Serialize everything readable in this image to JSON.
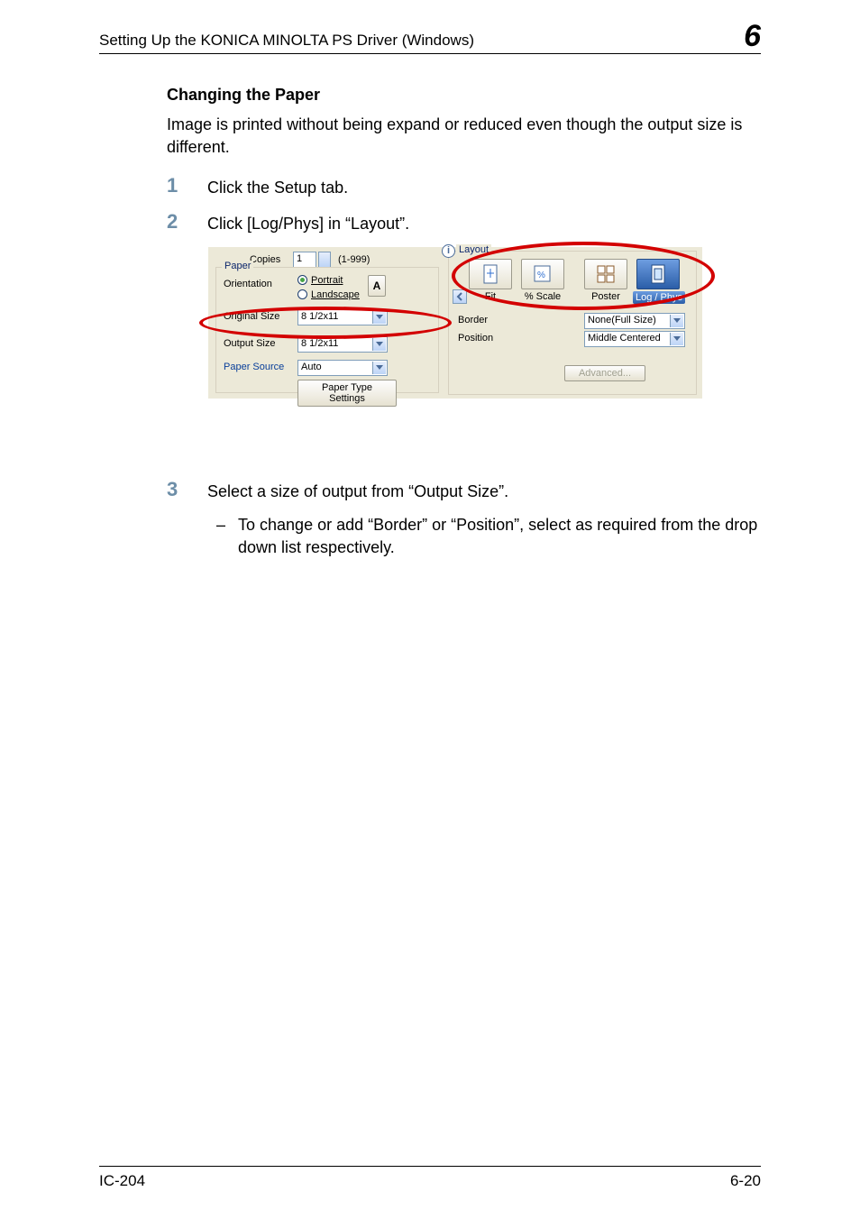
{
  "header": {
    "title": "Setting Up the KONICA MINOLTA PS Driver (Windows)",
    "chapter": "6"
  },
  "section": {
    "heading": "Changing the Paper",
    "intro": "Image is printed without being expand or reduced even though the output size is different.",
    "step1_text": "Click the Setup tab.",
    "step2_text": "Click [Log/Phys] in “Layout”.",
    "step3_text": "Select a size of output from “Output Size”.",
    "bullet_text": "To change or add “Border” or “Position”, select as required from the drop down list respectively."
  },
  "step_numbers": {
    "one": "1",
    "two": "2",
    "three": "3"
  },
  "dialog": {
    "copies_label": "Copies",
    "copies_value": "1",
    "copies_range": "(1-999)",
    "paper_legend": "Paper",
    "orientation_label": "Orientation",
    "portrait_label": "Portrait",
    "landscape_label": "Landscape",
    "rotate_glyph": "A",
    "original_size_label": "Original Size",
    "original_size_value": "8 1/2x11",
    "output_size_label": "Output Size",
    "output_size_value": "8 1/2x11",
    "paper_source_label": "Paper Source",
    "paper_source_value": "Auto",
    "paper_type_btn": "Paper Type Settings",
    "layout_legend": "Layout",
    "tab_fit": "Fit",
    "tab_scale": "% Scale",
    "tab_poster": "Poster",
    "tab_logphys": "Log / Phys",
    "border_label": "Border",
    "border_value": "None(Full Size)",
    "position_label": "Position",
    "position_value": "Middle Centered",
    "advanced_btn": "Advanced..."
  },
  "footer": {
    "left": "IC-204",
    "right": "6-20"
  }
}
